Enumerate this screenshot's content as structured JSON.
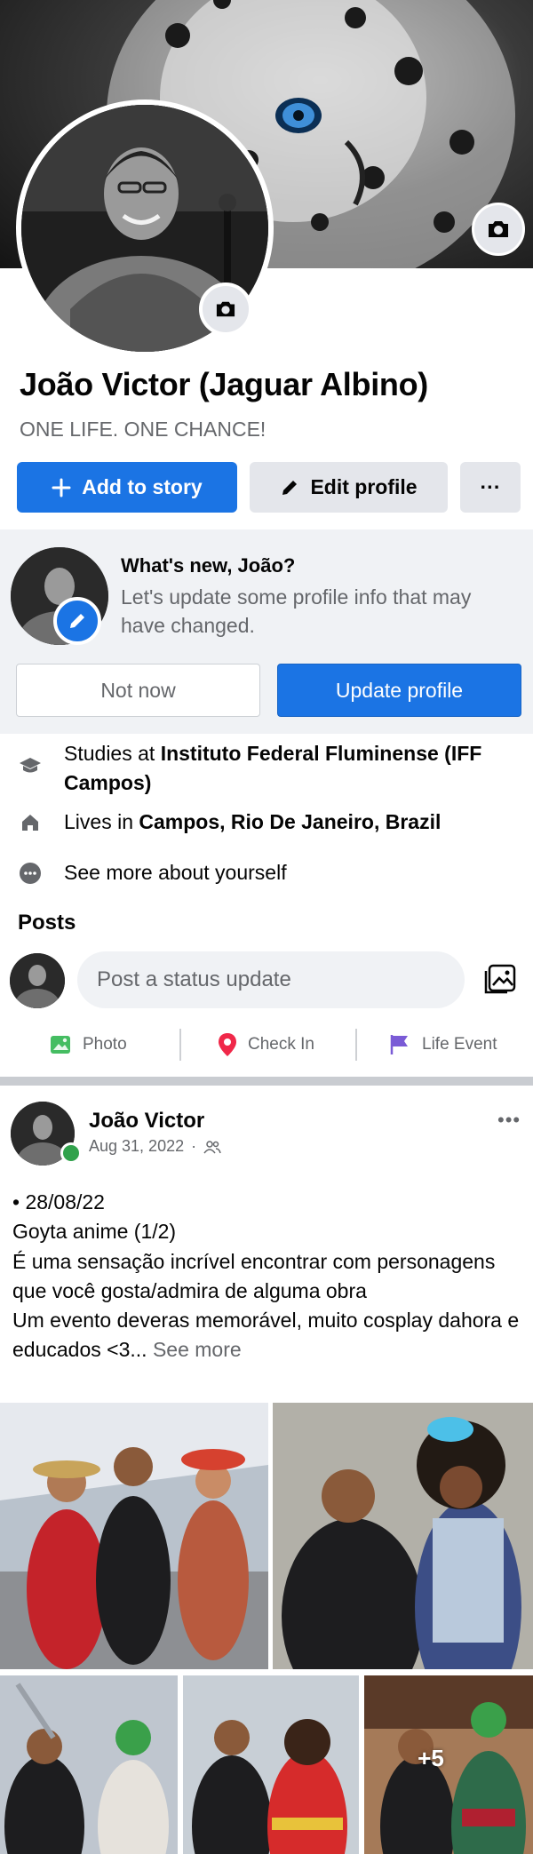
{
  "profile": {
    "name": "João Victor (Jaguar Albino)",
    "tagline": "ONE LIFE. ONE CHANCE!",
    "add_story_label": "Add to story",
    "edit_profile_label": "Edit profile",
    "more_label": "···"
  },
  "prompt": {
    "title": "What's new, João?",
    "text": "Let's update some profile info that may have changed.",
    "not_now_label": "Not now",
    "update_label": "Update profile"
  },
  "intro": {
    "studies_prefix": "Studies at ",
    "studies_place": "Instituto Federal Fluminense (IFF Campos)",
    "lives_prefix": "Lives in ",
    "lives_place": "Campos, Rio De Janeiro, Brazil",
    "see_more": "See more about yourself"
  },
  "posts_section": {
    "heading": "Posts",
    "composer_placeholder": "Post a status update",
    "actions": [
      {
        "label": "Photo",
        "icon": "photo-icon",
        "color": "#45bd62"
      },
      {
        "label": "Check In",
        "icon": "location-pin-icon",
        "color": "#f02849"
      },
      {
        "label": "Life Event",
        "icon": "flag-icon",
        "color": "#7a5bd6"
      }
    ]
  },
  "post": {
    "author": "João Victor",
    "date": "Aug 31, 2022",
    "separator": "·",
    "body_lines": [
      "• 28/08/22",
      "Goyta anime (1/2)",
      "É uma sensação incrível encontrar com personagens que você gosta/admira de alguma obra",
      "Um evento deveras memorável, muito cosplay dahora e educados <3..."
    ],
    "see_more": "See more",
    "extra_photos": "+5"
  },
  "colors": {
    "accent": "#1b74e4",
    "secondary_button": "#e4e6eb",
    "muted_text": "#65676b",
    "online": "#31a24c"
  }
}
